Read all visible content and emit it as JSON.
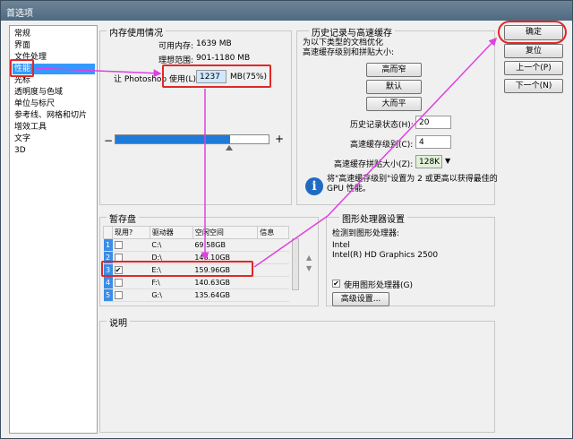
{
  "window": {
    "title": "首选项"
  },
  "sidebar": {
    "items": [
      {
        "label": "常规"
      },
      {
        "label": "界面"
      },
      {
        "label": "文件处理"
      },
      {
        "label": "性能",
        "selected": true
      },
      {
        "label": "光标"
      },
      {
        "label": "透明度与色域"
      },
      {
        "label": "单位与标尺"
      },
      {
        "label": "参考线、网格和切片"
      },
      {
        "label": "增效工具"
      },
      {
        "label": "文字"
      },
      {
        "label": "3D"
      }
    ]
  },
  "memory": {
    "legend": "内存使用情况",
    "available_label": "可用内存:",
    "available_value": "1639 MB",
    "ideal_label": "理想范围:",
    "ideal_value": "901-1180 MB",
    "let_label": "让 Photoshop 使用(L):",
    "use_value": "1237",
    "use_unit": "MB(75%)",
    "slider_fraction": 0.75,
    "minus": "−",
    "plus": "+"
  },
  "history": {
    "legend": "历史记录与高速缓存",
    "desc": "为以下类型的文档优化\n高速缓存级别和拼贴大小:",
    "btn_tall_thin": "高而窄",
    "btn_default": "默认",
    "btn_big_flat": "大而平",
    "states_label": "历史记录状态(H):",
    "states_value": "20",
    "cache_levels_label": "高速缓存级别(C):",
    "cache_levels_value": "4",
    "tile_size_label": "高速缓存拼贴大小(Z):",
    "tile_size_value": "128K",
    "info": "将\"高速缓存级别\"设置为 2 或更高以获得最佳的\nGPU 性能。"
  },
  "scratch": {
    "legend": "暂存盘",
    "headers": [
      "现用?",
      "驱动器",
      "空闲空间",
      "信息"
    ],
    "rows": [
      {
        "n": "1",
        "active": false,
        "drive": "C:\\",
        "free": "69.58GB"
      },
      {
        "n": "2",
        "active": false,
        "drive": "D:\\",
        "free": "148.10GB"
      },
      {
        "n": "3",
        "active": true,
        "drive": "E:\\",
        "free": "159.96GB"
      },
      {
        "n": "4",
        "active": false,
        "drive": "F:\\",
        "free": "140.63GB"
      },
      {
        "n": "5",
        "active": false,
        "drive": "G:\\",
        "free": "135.64GB"
      }
    ],
    "checkmark": "✔"
  },
  "gpu": {
    "legend": "图形处理器设置",
    "detected_label": "检测到图形处理器:",
    "vendor": "Intel",
    "model": "Intel(R) HD Graphics 2500",
    "use_gpu_label": "使用图形处理器(G)",
    "advanced_button": "高级设置..."
  },
  "description": {
    "legend": "说明"
  },
  "buttons": {
    "ok": "确定",
    "reset": "复位",
    "prev": "上一个(P)",
    "next": "下一个(N)"
  }
}
